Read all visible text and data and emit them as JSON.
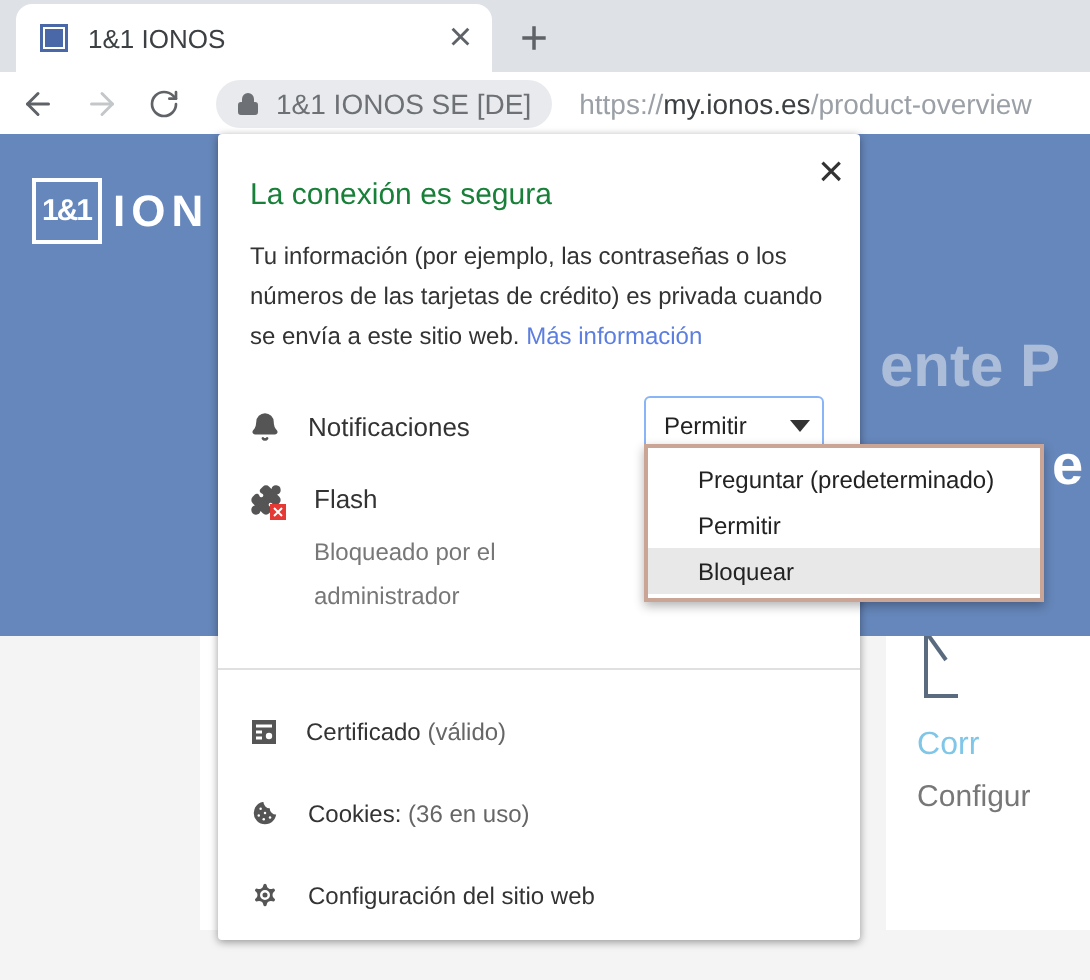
{
  "tab": {
    "title": "1&1 IONOS",
    "close": "×",
    "new_tab": "+"
  },
  "address_bar": {
    "site_label": "1&1 IONOS SE [DE]",
    "scheme": "https://",
    "host": "my.ionos.es",
    "path": "/product-overview"
  },
  "page": {
    "logo": {
      "mark": "1&1",
      "word": "ION"
    },
    "heading": "ente P",
    "heading_right": "e",
    "card": {
      "title": "Corr",
      "text": "Configur"
    }
  },
  "popup": {
    "title": "La conexión es segura",
    "close": "×",
    "description": "Tu información (por ejemplo, las contraseñas o los números de las tarjetas de crédito) es privada cuando se envía a este sitio web.",
    "link": "Más información",
    "permissions": [
      {
        "kind": "select",
        "label": "Notificaciones",
        "value": "Permitir",
        "expanded": true
      },
      {
        "kind": "blocked",
        "label": "Flash",
        "note": "Bloqueado por el administrador"
      }
    ],
    "options": [
      {
        "label": "Preguntar (predeterminado)",
        "selected": false
      },
      {
        "label": "Permitir",
        "selected": false
      },
      {
        "label": "Bloquear",
        "selected": true
      }
    ],
    "links": [
      {
        "kind": "certificate",
        "label": "Certificado",
        "detail": "(válido)"
      },
      {
        "kind": "cookies",
        "label": "Cookies:",
        "detail": "(36 en uso)"
      },
      {
        "kind": "settings",
        "label": "Configuración del sitio web"
      }
    ]
  }
}
